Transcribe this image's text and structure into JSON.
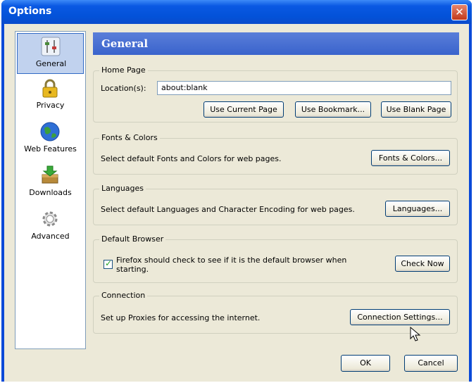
{
  "window": {
    "title": "Options",
    "close_icon": "✕"
  },
  "sidebar": {
    "items": [
      {
        "label": "General",
        "icon": "general-sliders-icon"
      },
      {
        "label": "Privacy",
        "icon": "lock-icon"
      },
      {
        "label": "Web Features",
        "icon": "globe-icon"
      },
      {
        "label": "Downloads",
        "icon": "downloads-icon"
      },
      {
        "label": "Advanced",
        "icon": "gear-icon"
      }
    ]
  },
  "header": {
    "title": "General"
  },
  "home_page": {
    "title": "Home Page",
    "location_label": "Location(s):",
    "location_value": "about:blank",
    "use_current_label": "Use Current Page",
    "use_bookmark_label": "Use Bookmark...",
    "use_blank_label": "Use Blank Page"
  },
  "fonts_colors": {
    "title": "Fonts & Colors",
    "description": "Select default Fonts and Colors for web pages.",
    "button_label": "Fonts & Colors..."
  },
  "languages": {
    "title": "Languages",
    "description": "Select default Languages and Character Encoding for web pages.",
    "button_label": "Languages..."
  },
  "default_browser": {
    "title": "Default Browser",
    "checkbox_label_line1": "Firefox should check to see if it is the default browser when",
    "checkbox_label_line2": "starting.",
    "checked": true,
    "button_label": "Check Now"
  },
  "connection": {
    "title": "Connection",
    "description": "Set up Proxies for accessing the internet.",
    "button_label": "Connection Settings..."
  },
  "footer": {
    "ok_label": "OK",
    "cancel_label": "Cancel"
  }
}
